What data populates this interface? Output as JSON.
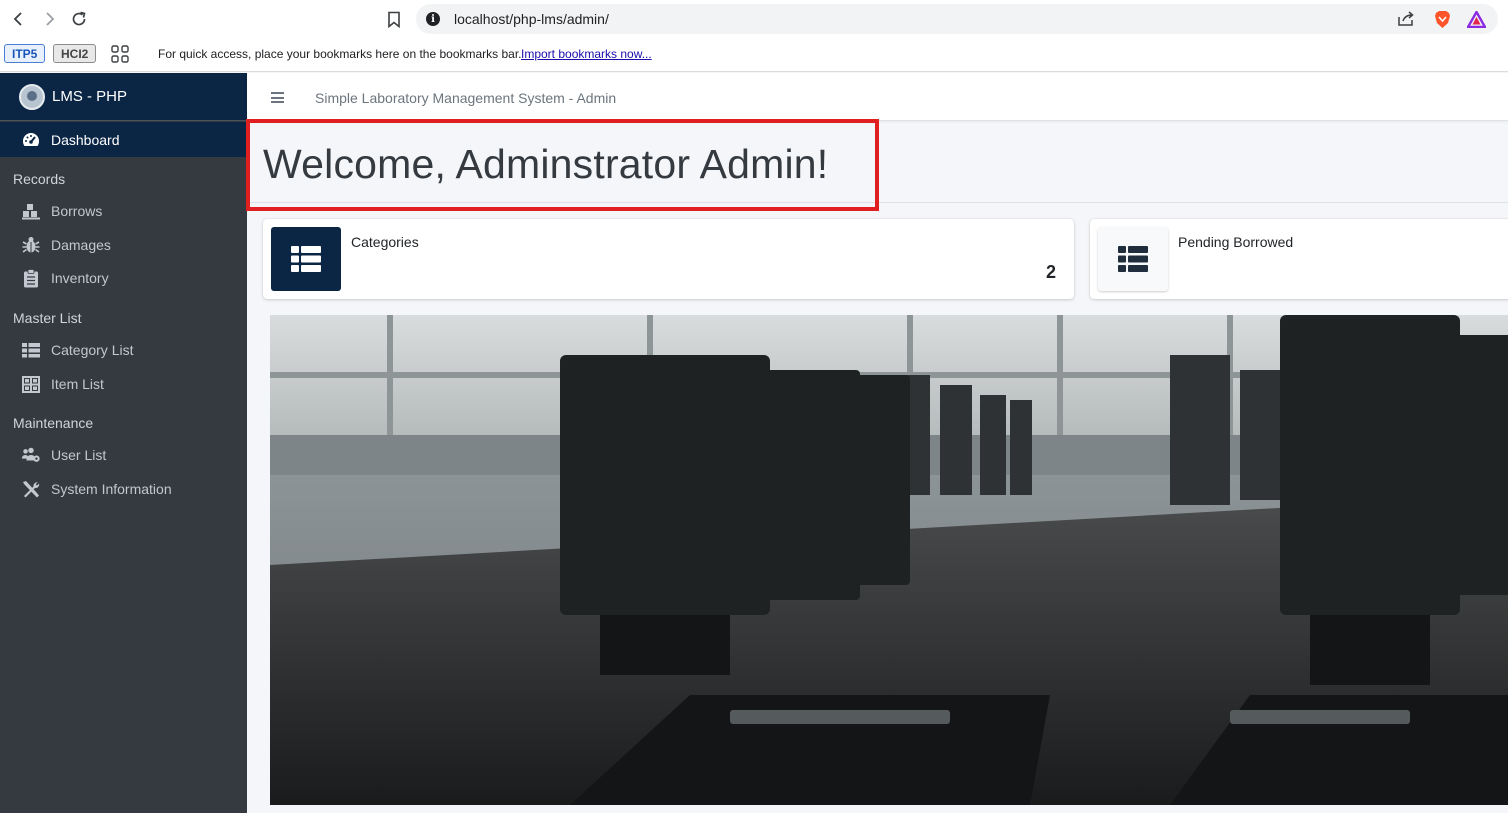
{
  "browser": {
    "url": "localhost/php-lms/admin/",
    "bookmarks": [
      "ITP5",
      "HCI2"
    ],
    "bookmarks_hint": "For quick access, place your bookmarks here on the bookmarks bar.",
    "import_link": "Import bookmarks now..."
  },
  "sidebar": {
    "brand": "LMS - PHP",
    "dashboard": "Dashboard",
    "sections": [
      {
        "header": "Records",
        "items": [
          "Borrows",
          "Damages",
          "Inventory"
        ]
      },
      {
        "header": "Master List",
        "items": [
          "Category List",
          "Item List"
        ]
      },
      {
        "header": "Maintenance",
        "items": [
          "User List",
          "System Information"
        ]
      }
    ]
  },
  "header": {
    "title": "Simple Laboratory Management System - Admin"
  },
  "main": {
    "welcome": "Welcome, Adminstrator Admin!",
    "cards": [
      {
        "label": "Categories",
        "value": "2"
      },
      {
        "label": "Pending Borrowed",
        "value": ""
      }
    ]
  },
  "colors": {
    "sidebar_bg": "#343a40",
    "brand_bg": "#0b2545",
    "highlight": "#e02020"
  }
}
